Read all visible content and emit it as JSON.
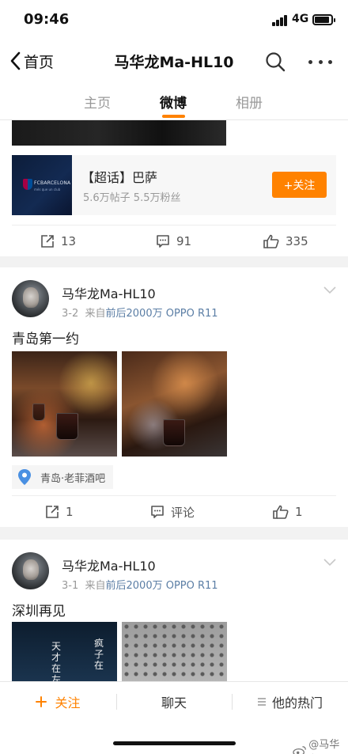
{
  "status_bar": {
    "time": "09:46",
    "network": "4G"
  },
  "nav": {
    "back_label": "首页",
    "title": "马华龙Ma-HL10"
  },
  "tabs": [
    {
      "label": "主页",
      "active": false
    },
    {
      "label": "微博",
      "active": true
    },
    {
      "label": "相册",
      "active": false
    }
  ],
  "post0": {
    "topic": {
      "name": "【超话】巴萨",
      "stats": "5.6万帖子  5.5万粉丝",
      "follow_label": "+关注",
      "thumb_text": "FCBARCELONA",
      "thumb_subtext": "més que un club"
    },
    "actions": {
      "repost": "13",
      "comment": "91",
      "like": "335"
    }
  },
  "post1": {
    "user": "马华龙Ma-HL10",
    "date": "3-2",
    "via": "来自",
    "source": "前后2000万 OPPO R11",
    "text": "青岛第一约",
    "location": "青岛·老菲酒吧",
    "actions": {
      "repost": "1",
      "comment": "评论",
      "like": "1"
    }
  },
  "post2": {
    "user": "马华龙Ma-HL10",
    "date": "3-1",
    "via": "来自",
    "source": "前后2000万 OPPO R11",
    "text": "深圳再见",
    "image_calligraphy": [
      "天",
      "才",
      "在",
      "左"
    ],
    "image_calligraphy2": [
      "疯",
      "子",
      "在"
    ]
  },
  "bottom_bar": {
    "follow": "关注",
    "chat": "聊天",
    "hot": "他的热门",
    "watermark": "@马华龙"
  },
  "colors": {
    "accent": "#ff8200",
    "link": "#5b7ea5"
  }
}
